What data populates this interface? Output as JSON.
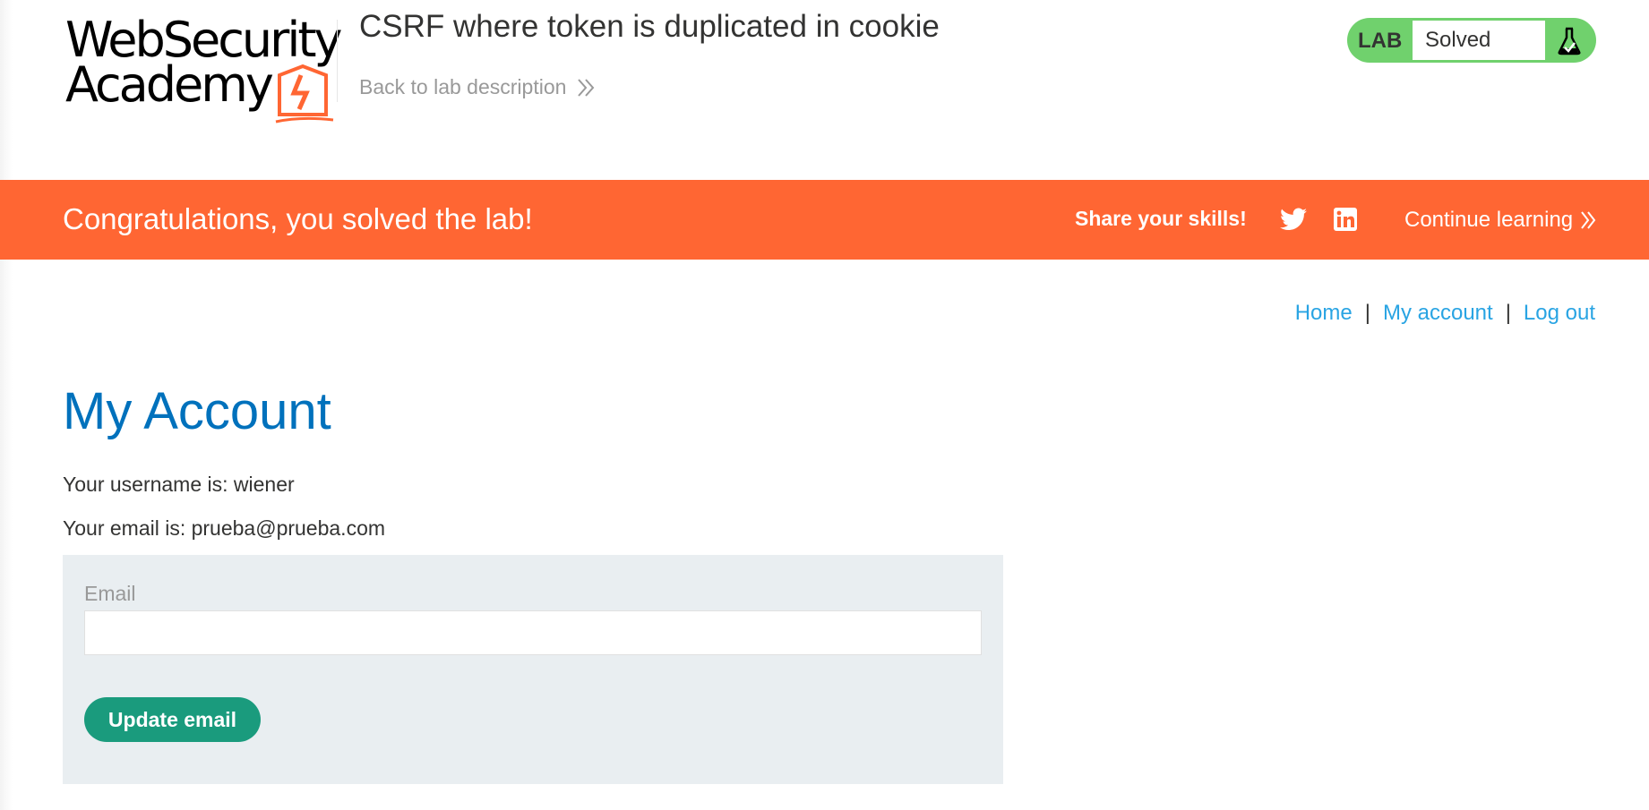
{
  "logo": {
    "line1": "WebSecurity",
    "line2": "Academy"
  },
  "header": {
    "lab_title": "CSRF where token is duplicated in cookie",
    "back_link": "Back to lab description"
  },
  "lab_status": {
    "label": "LAB",
    "status": "Solved"
  },
  "banner": {
    "message": "Congratulations, you solved the lab!",
    "share_label": "Share your skills!",
    "continue_label": "Continue learning"
  },
  "nav": {
    "home": "Home",
    "separator": "|",
    "my_account": "My account",
    "log_out": "Log out"
  },
  "main": {
    "title": "My Account",
    "username_line": "Your username is: wiener",
    "email_line": "Your email is: prueba@prueba.com",
    "form": {
      "email_label": "Email",
      "email_value": "",
      "submit_label": "Update email"
    }
  },
  "icons": {
    "lab_status": "flask-icon",
    "share": [
      "twitter-icon",
      "linkedin-icon"
    ],
    "chevrons": "double-chevron-right-icon"
  },
  "colors": {
    "banner": "#ff6633",
    "lab_solved": "#70d16d",
    "link": "#29a4e3",
    "title": "#0071bc",
    "button": "#1a9b7d",
    "form_bg": "#e9eef1"
  }
}
